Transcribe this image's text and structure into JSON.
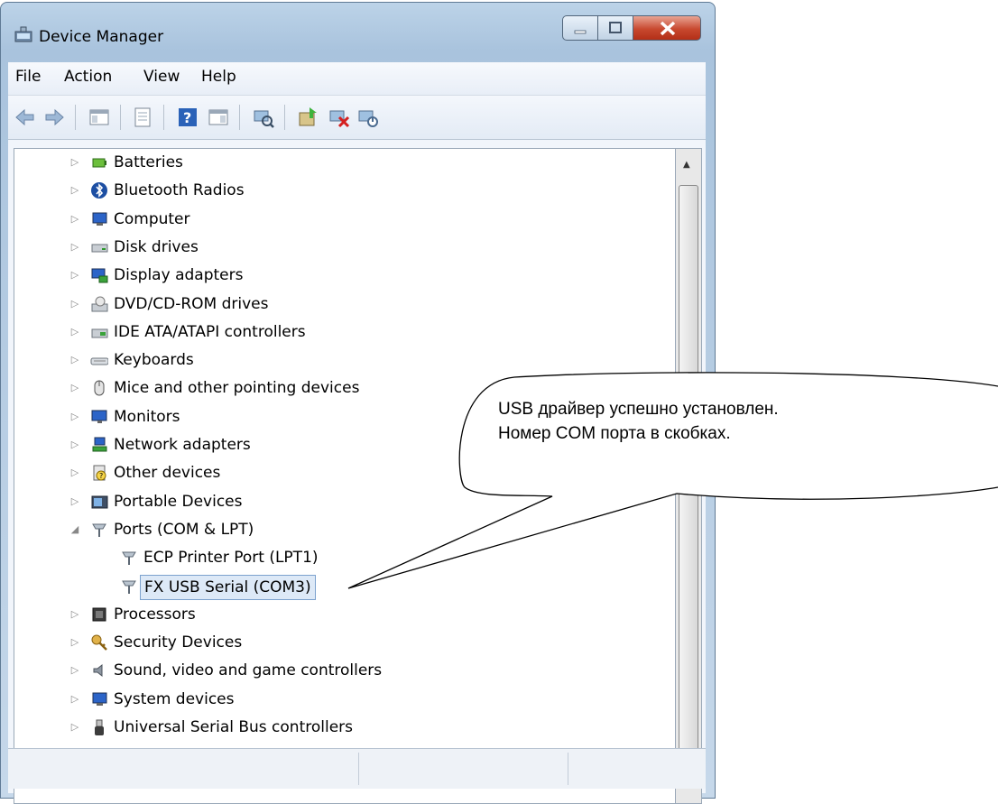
{
  "window": {
    "title": "Device Manager",
    "icon": "device-manager-icon",
    "controls": {
      "minimize": "minimize-icon",
      "maximize": "maximize-icon",
      "close": "close-icon"
    }
  },
  "menu": [
    "File",
    "Action",
    "View",
    "Help"
  ],
  "toolbar": [
    "back-icon",
    "forward-icon",
    "show-hide-console-tree-icon",
    "properties-icon",
    "help-icon",
    "action-pane-icon",
    "scan-hardware-icon",
    "update-driver-icon",
    "uninstall-icon",
    "disable-icon"
  ],
  "tree": {
    "nodes": [
      {
        "label": "Batteries",
        "icon": "battery-icon",
        "expanded": false
      },
      {
        "label": "Bluetooth Radios",
        "icon": "bluetooth-icon",
        "expanded": false
      },
      {
        "label": "Computer",
        "icon": "computer-icon",
        "expanded": false
      },
      {
        "label": "Disk drives",
        "icon": "disk-drive-icon",
        "expanded": false
      },
      {
        "label": "Display adapters",
        "icon": "display-adapter-icon",
        "expanded": false
      },
      {
        "label": "DVD/CD-ROM drives",
        "icon": "dvd-drive-icon",
        "expanded": false
      },
      {
        "label": "IDE ATA/ATAPI controllers",
        "icon": "ide-controller-icon",
        "expanded": false
      },
      {
        "label": "Keyboards",
        "icon": "keyboard-icon",
        "expanded": false
      },
      {
        "label": "Mice and other pointing devices",
        "icon": "mouse-icon",
        "expanded": false
      },
      {
        "label": "Monitors",
        "icon": "monitor-icon",
        "expanded": false
      },
      {
        "label": "Network adapters",
        "icon": "network-adapter-icon",
        "expanded": false
      },
      {
        "label": "Other devices",
        "icon": "other-devices-icon",
        "expanded": false
      },
      {
        "label": "Portable Devices",
        "icon": "portable-devices-icon",
        "expanded": false
      },
      {
        "label": "Ports (COM & LPT)",
        "icon": "port-icon",
        "expanded": true,
        "children": [
          {
            "label": "ECP Printer Port (LPT1)",
            "icon": "port-icon"
          },
          {
            "label": "FX USB Serial (COM3)",
            "icon": "port-icon",
            "selected": true
          }
        ]
      },
      {
        "label": "Processors",
        "icon": "processor-icon",
        "expanded": false
      },
      {
        "label": "Security Devices",
        "icon": "security-key-icon",
        "expanded": false
      },
      {
        "label": "Sound, video and game controllers",
        "icon": "speaker-icon",
        "expanded": false
      },
      {
        "label": "System devices",
        "icon": "system-devices-icon",
        "expanded": false
      },
      {
        "label": "Universal Serial Bus controllers",
        "icon": "usb-icon",
        "expanded": false
      }
    ]
  },
  "callout": {
    "line1": "USB драйвер успешно установлен.",
    "line2": "Номер COM порта в скобках."
  }
}
